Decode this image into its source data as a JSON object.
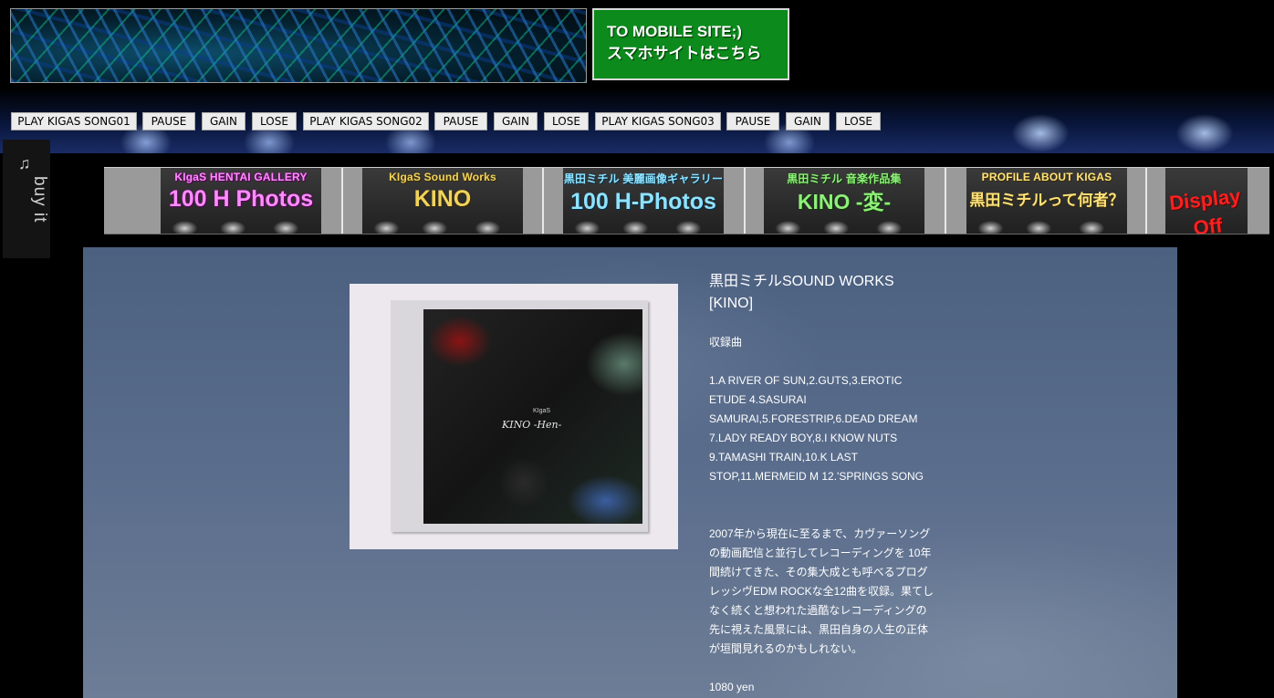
{
  "header": {
    "banner_alt": "KIGAS banner",
    "mobile_button": {
      "line1": "TO MOBILE SITE;)",
      "line2": "スマホサイトはこちら"
    }
  },
  "player": {
    "buttons": [
      "PLAY KIGAS SONG01",
      "PAUSE",
      "GAIN",
      "LOSE",
      "PLAY KIGAS SONG02",
      "PAUSE",
      "GAIN",
      "LOSE",
      "PLAY KIGAS SONG03",
      "PAUSE",
      "GAIN",
      "LOSE"
    ]
  },
  "buy_tab": {
    "icon": "music-note-icon",
    "label": "buy it"
  },
  "nav": [
    {
      "small": "KIgaS HENTAI GALLERY",
      "big": "100 H Photos"
    },
    {
      "small": "KIgaS Sound Works",
      "big": "KINO"
    },
    {
      "small": "黒田ミチル 美麗画像ギャラリー",
      "big": "100 H-Photos"
    },
    {
      "small": "黒田ミチル 音楽作品集",
      "big": "KINO -変-"
    },
    {
      "small": "PROFILE ABOUT KIGAS",
      "big": "黒田ミチルって何者？"
    },
    {
      "small": "",
      "big": "Display Off"
    }
  ],
  "product": {
    "cover_brand": "KIgaS",
    "cover_title": "KINO -Hen-",
    "title_line1": "黒田ミチルSOUND WORKS",
    "title_line2": "[KINO]",
    "tracklist_heading": "収録曲",
    "tracklist": [
      "1.A RIVER OF SUN,2.GUTS,3.EROTIC",
      "ETUDE 4.SASURAI",
      "SAMURAI,5.FORESTRIP,6.DEAD DREAM",
      "7.LADY READY BOY,8.I KNOW NUTS",
      "9.TAMASHI TRAIN,10.K LAST",
      "STOP,11.MERMEID M 12.'SPRINGS SONG"
    ],
    "description": [
      "2007年から現在に至るまで、カヴァーソング",
      "の動画配信と並行してレコーディングを 10年",
      "間続けてきた、その集大成とも呼べるプログ",
      "レッシヴEDM ROCKな全12曲を収録。果てし",
      "なく続くと想われた過酷なレコーディングの",
      "先に視えた風景には、黒田自身の人生の正体",
      "が垣間見れるのかもしれない。"
    ],
    "price": "1080 yen"
  },
  "colors": {
    "mobile_green": "#0c8a1c",
    "content_bg": "#5a6d8c"
  }
}
